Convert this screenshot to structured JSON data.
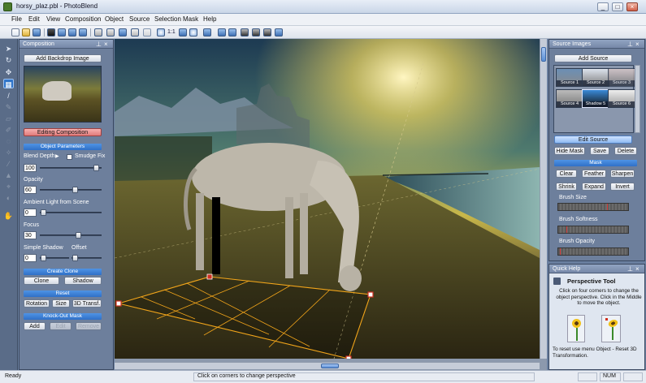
{
  "window": {
    "title": "horsy_plaz.pbl - PhotoBlend",
    "minimize": "_",
    "maximize": "□",
    "close": "×"
  },
  "menu": [
    "File",
    "Edit",
    "View",
    "Composition",
    "Object",
    "Source",
    "Selection",
    "Mask",
    "Help"
  ],
  "toolbar": {
    "zoom_label": "1:1"
  },
  "composition_panel": {
    "title": "Composition",
    "add_backdrop": "Add Backdrop Image",
    "editing_composition": "Editing Composition",
    "object_parameters": "Object Parameters",
    "blend_depth_label": "Blend Depth",
    "smudge_fix_label": "Smudge Fix",
    "blend_depth_value": "100",
    "opacity_label": "Opacity",
    "opacity_value": "60",
    "ambient_label": "Ambient Light from Scene",
    "ambient_value": "0",
    "focus_label": "Focus",
    "focus_value": "30",
    "shadow_label": "Simple Shadow",
    "offset_label": "Offset",
    "shadow_value": "0",
    "create_clone": "Create Clone",
    "clone_btn": "Clone",
    "shadow_btn": "Shadow",
    "reset": "Reset",
    "rotation_btn": "Rotation",
    "size_btn": "Size",
    "transf_btn": "3D Transf.",
    "knockout_mask": "Knock-Out Mask",
    "add_btn": "Add",
    "edit_btn": "Edit",
    "remove_btn": "Remove"
  },
  "source_panel": {
    "title": "Source Images",
    "add_source": "Add Source",
    "thumbs": [
      "Source 1",
      "Source 2",
      "Source 3",
      "Source 4",
      "Shadow 5",
      "Source 6"
    ],
    "edit_source": "Edit Source",
    "hide_mask": "Hide Mask",
    "save": "Save",
    "delete": "Delete",
    "mask": "Mask",
    "clear": "Clear",
    "feather": "Feather",
    "sharpen": "Sharpen",
    "shrink": "Shrink",
    "expand": "Expand",
    "invert": "Invert",
    "brush_size": "Brush Size",
    "brush_softness": "Brush Softness",
    "brush_opacity": "Brush Opacity"
  },
  "quick_help": {
    "title": "Quick Help",
    "heading": "Perspective Tool",
    "text": "Click on four corners to change the object perspective. Click in the Middle to move the object.",
    "reset_text": "To reset use menu Object - Reset 3D Transformation."
  },
  "status": {
    "left": "Ready",
    "center": "Click on corners to change perspective",
    "num": "NUM"
  },
  "colors": {
    "accent": "#2f70c7",
    "editing_red": "#e07b7b",
    "panel_bg": "#6d7f9c"
  }
}
